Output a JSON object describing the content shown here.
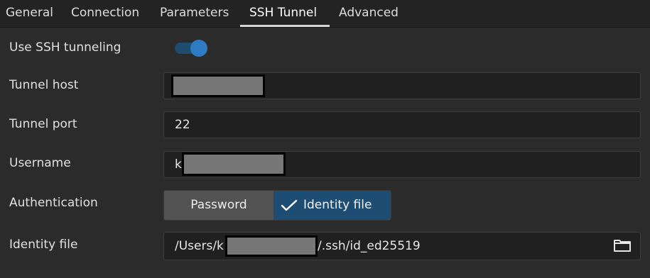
{
  "tabs": [
    {
      "label": "General"
    },
    {
      "label": "Connection"
    },
    {
      "label": "Parameters"
    },
    {
      "label": "SSH Tunnel"
    },
    {
      "label": "Advanced"
    }
  ],
  "active_tab": "SSH Tunnel",
  "form": {
    "use_ssh": {
      "label": "Use SSH tunneling",
      "enabled": true
    },
    "tunnel_host": {
      "label": "Tunnel host",
      "value": ""
    },
    "tunnel_port": {
      "label": "Tunnel port",
      "value": "22"
    },
    "username": {
      "label": "Username",
      "value_prefix": "k"
    },
    "authentication": {
      "label": "Authentication",
      "options": [
        "Password",
        "Identity file"
      ],
      "selected": "Identity file"
    },
    "identity_file": {
      "label": "Identity file",
      "value_prefix": "/Users/k",
      "value_suffix": "/.ssh/id_ed25519"
    }
  },
  "colors": {
    "accent": "#2f7cc4",
    "selected_segment": "#1e4d74",
    "background": "#2b2b2b"
  },
  "icons": {
    "check": "check-icon",
    "folder": "folder-icon"
  }
}
